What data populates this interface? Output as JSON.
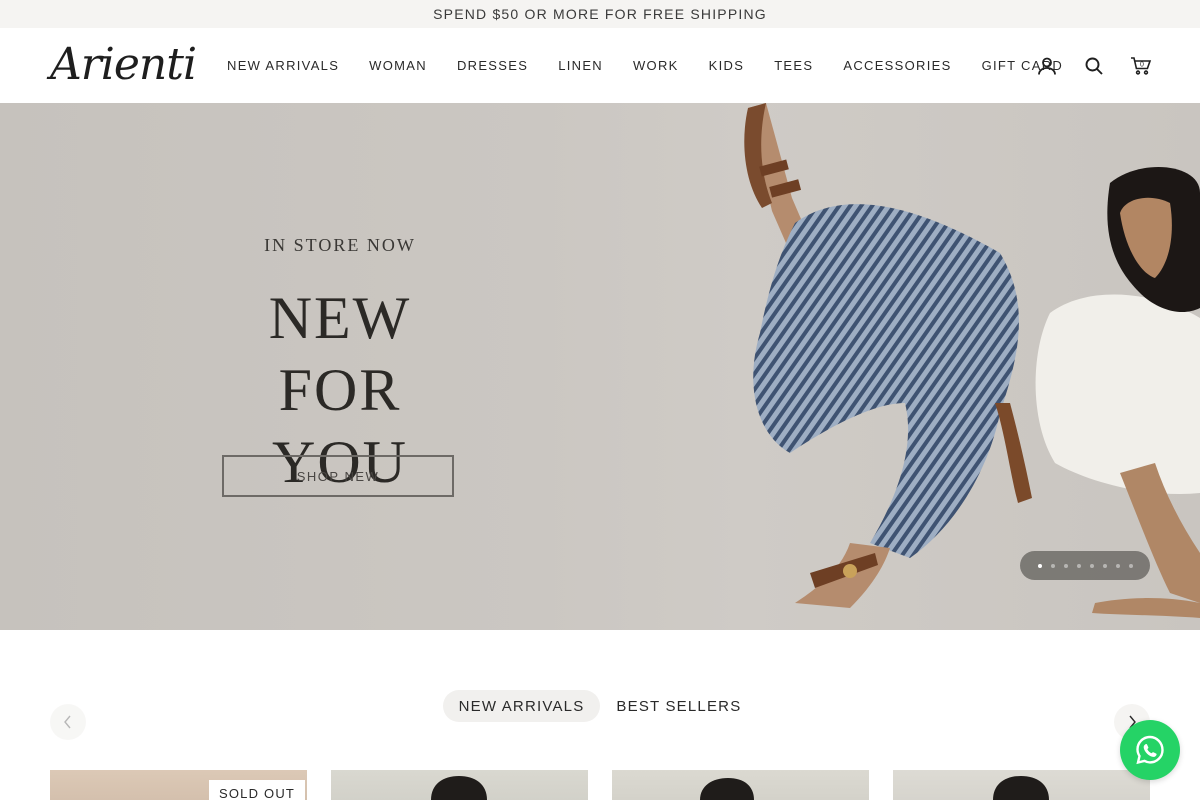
{
  "announcement": {
    "text": "SPEND $50 OR MORE FOR FREE SHIPPING"
  },
  "header": {
    "logo_text": "Arienti",
    "nav": [
      "NEW ARRIVALS",
      "WOMAN",
      "DRESSES",
      "LINEN",
      "WORK",
      "KIDS",
      "TEES",
      "ACCESSORIES",
      "GIFT CARD"
    ],
    "icons": [
      "account-icon",
      "search-icon",
      "cart-icon"
    ],
    "cart_count": "0"
  },
  "hero": {
    "eyebrow": "IN STORE NOW",
    "title_line1": "NEW",
    "title_line2": "FOR YOU",
    "cta": "SHOP NEW",
    "slides_total": 8,
    "active_slide": 1
  },
  "collection_tabs": {
    "tabs": [
      "NEW ARRIVALS",
      "BEST SELLERS"
    ],
    "active": "NEW ARRIVALS"
  },
  "products": {
    "badge": "SOLD OUT"
  },
  "colors": {
    "announcement_bg": "#f5f4f2",
    "hero_bg": "#c8c4bf",
    "whatsapp": "#25d366",
    "text": "#1f1f1f"
  }
}
